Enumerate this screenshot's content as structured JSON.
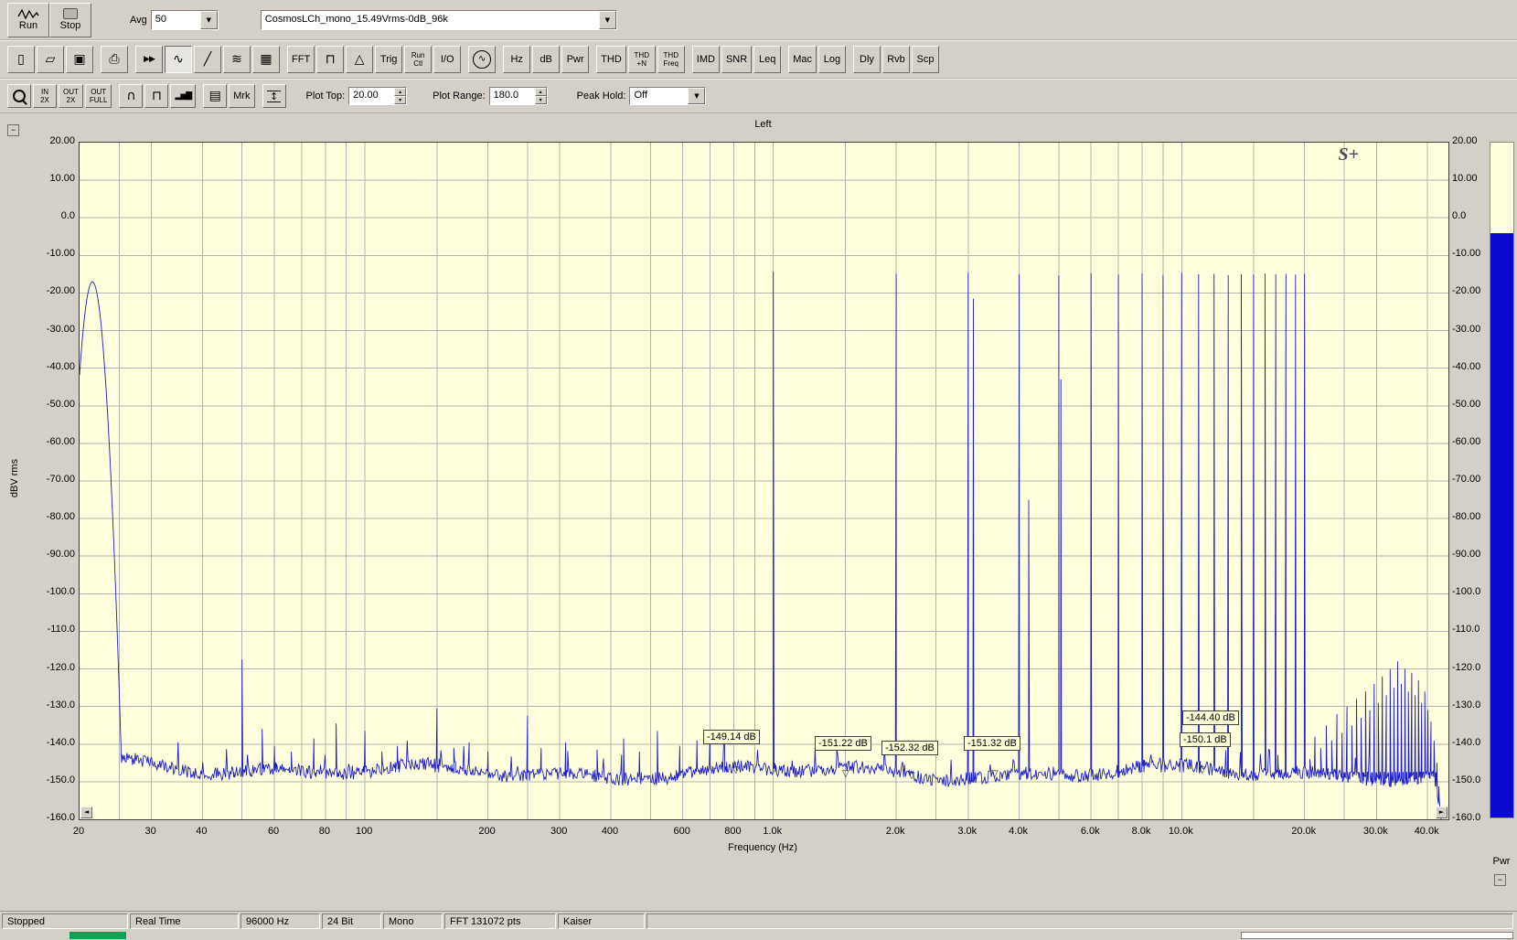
{
  "window": {
    "bg": "#d4d0c8"
  },
  "icons": {
    "collapse": "−",
    "scroll_left": "◄",
    "scroll_right": "►",
    "spin_up": "▴",
    "spin_down": "▾",
    "dropdown": "▼"
  },
  "logo_text": "S+",
  "toolbar_top": {
    "run": {
      "label": "Run"
    },
    "stop": {
      "label": "Stop"
    },
    "avg_label": "Avg",
    "avg_value": "50",
    "file_combo": "CosmosLCh_mono_15.49Vrms-0dB_96k"
  },
  "toolbar_main": {
    "groups": [
      [
        {
          "name": "new-file-button",
          "glyph": "▯"
        },
        {
          "name": "open-file-button",
          "glyph": "▱"
        },
        {
          "name": "save-button",
          "glyph": "▣"
        }
      ],
      [
        {
          "name": "print-button",
          "glyph": "⎙"
        }
      ],
      [
        {
          "name": "fast-forward-button",
          "glyph": "▶▶",
          "small": true
        },
        {
          "name": "spectrum-view-button",
          "glyph": "∿",
          "pressed": true
        },
        {
          "name": "slope-line-button",
          "glyph": "╱"
        },
        {
          "name": "multi-spectra-button",
          "glyph": "≋"
        },
        {
          "name": "spectrogram-view-button",
          "glyph": "▦"
        }
      ],
      [
        {
          "name": "fft-button",
          "label": "FFT"
        },
        {
          "name": "step-plot-button",
          "glyph": "⊓"
        },
        {
          "name": "sweep-button",
          "glyph": "△"
        },
        {
          "name": "trigger-button",
          "label": "Trig"
        },
        {
          "name": "run-control-button",
          "lines": [
            "Run",
            "Ctl"
          ]
        },
        {
          "name": "io-button",
          "label": "I/O"
        }
      ],
      [
        {
          "name": "signal-generator-button",
          "glyph": "∿",
          "circle": true
        }
      ],
      [
        {
          "name": "hz-button",
          "label": "Hz"
        },
        {
          "name": "db-button",
          "label": "dB"
        },
        {
          "name": "pwr-button",
          "label": "Pwr"
        }
      ],
      [
        {
          "name": "thd-button",
          "label": "THD"
        },
        {
          "name": "thd-n-button",
          "lines": [
            "THD",
            "+N"
          ]
        },
        {
          "name": "thd-freq-button",
          "lines": [
            "THD",
            "Freq"
          ]
        }
      ],
      [
        {
          "name": "imd-button",
          "label": "IMD"
        },
        {
          "name": "snr-button",
          "label": "SNR"
        },
        {
          "name": "leq-button",
          "label": "Leq"
        }
      ],
      [
        {
          "name": "mac-button",
          "label": "Mac"
        },
        {
          "name": "log-button",
          "label": "Log"
        }
      ],
      [
        {
          "name": "dly-button",
          "label": "Dly"
        },
        {
          "name": "rvb-button",
          "label": "Rvb"
        },
        {
          "name": "scp-button",
          "label": "Scp"
        }
      ]
    ]
  },
  "toolbar_plot": {
    "groups": [
      [
        {
          "name": "zoom-button",
          "mag": true
        },
        {
          "name": "zoom-in-2x-button",
          "lines": [
            "IN",
            "2X"
          ]
        },
        {
          "name": "zoom-out-2x-button",
          "lines": [
            "OUT",
            "2X"
          ]
        },
        {
          "name": "zoom-out-full-button",
          "lines": [
            "OUT",
            "FULL"
          ]
        }
      ],
      [
        {
          "name": "probability-plot-button",
          "glyph": "∩"
        },
        {
          "name": "pulse-plot-button",
          "glyph": "⊓"
        },
        {
          "name": "histogram-button",
          "glyph": "▂▅▇",
          "small": true
        }
      ],
      [
        {
          "name": "display-config-button",
          "glyph": "▤"
        },
        {
          "name": "marker-toggle-button",
          "label": "Mrk"
        }
      ],
      [
        {
          "name": "cursor-readout-button",
          "glyph": "↕",
          "boxed": true
        }
      ]
    ],
    "plot_top_label": "Plot Top:",
    "plot_top_value": "20.00",
    "plot_range_label": "Plot Range:",
    "plot_range_value": "180.0",
    "peak_hold_label": "Peak Hold:",
    "peak_hold_value": "Off"
  },
  "chart_data": {
    "type": "line",
    "title": "Left",
    "xlabel": "Frequency (Hz)",
    "ylabel": "dBV rms",
    "x_scale": "log",
    "xlim": [
      20,
      45000
    ],
    "ylim": [
      -160,
      20
    ],
    "bg": "#ffffde",
    "grid_color": "#b3b3b3",
    "trace_color": "#1e1ec8",
    "y_tick_labels": [
      "20.00",
      "10.00",
      "0.0",
      "-10.00",
      "-20.00",
      "-30.00",
      "-40.00",
      "-50.00",
      "-60.00",
      "-70.00",
      "-80.00",
      "-90.00",
      "-100.0",
      "-110.0",
      "-120.0",
      "-130.0",
      "-140.0",
      "-150.0",
      "-160.0"
    ],
    "x_ticks": [
      [
        "20",
        20
      ],
      [
        "30",
        30
      ],
      [
        "40",
        40
      ],
      [
        "60",
        60
      ],
      [
        "80",
        80
      ],
      [
        "100",
        100
      ],
      [
        "200",
        200
      ],
      [
        "300",
        300
      ],
      [
        "400",
        400
      ],
      [
        "600",
        600
      ],
      [
        "800",
        800
      ],
      [
        "1.0k",
        1000
      ],
      [
        "2.0k",
        2000
      ],
      [
        "3.0k",
        3000
      ],
      [
        "4.0k",
        4000
      ],
      [
        "6.0k",
        6000
      ],
      [
        "8.0k",
        8000
      ],
      [
        "10.0k",
        10000
      ],
      [
        "20.0k",
        20000
      ],
      [
        "30.0k",
        30000
      ],
      [
        "40.0k",
        40000
      ]
    ],
    "grid_freqs": [
      25,
      30,
      40,
      50,
      60,
      70,
      80,
      90,
      100,
      150,
      200,
      250,
      300,
      400,
      500,
      600,
      700,
      800,
      900,
      1000,
      1500,
      2000,
      2500,
      3000,
      4000,
      5000,
      6000,
      7000,
      8000,
      9000,
      10000,
      15000,
      20000,
      25000,
      30000,
      40000
    ],
    "noise_floor_db": -147.5,
    "lf_hump": {
      "f": 21.5,
      "db": -17
    },
    "mains_peak": {
      "f": 50,
      "db": -117.5
    },
    "tones": [
      [
        1000,
        -14.4
      ],
      [
        2000,
        -14.9
      ],
      [
        3000,
        -14.6
      ],
      [
        4000,
        -15.0
      ],
      [
        5000,
        -15.3
      ],
      [
        6000,
        -14.7
      ],
      [
        7000,
        -15.1
      ],
      [
        8000,
        -14.8
      ],
      [
        9000,
        -15.2
      ],
      [
        10000,
        -14.6
      ],
      [
        11000,
        -15.0
      ],
      [
        12000,
        -14.9
      ],
      [
        13000,
        -15.2
      ],
      [
        14000,
        -15.0
      ],
      [
        15000,
        -15.1
      ],
      [
        16000,
        -14.8
      ],
      [
        17000,
        -15.0
      ],
      [
        18000,
        -14.9
      ],
      [
        19000,
        -15.1
      ],
      [
        20000,
        -14.9
      ]
    ],
    "spurs": [
      [
        56,
        -136
      ],
      [
        60,
        -140.5
      ],
      [
        66,
        -142
      ],
      [
        75,
        -138.5
      ],
      [
        85,
        -134.5
      ],
      [
        100,
        -136.5
      ],
      [
        110,
        -142
      ],
      [
        120,
        -140.5
      ],
      [
        150,
        -130.5
      ],
      [
        165,
        -141
      ],
      [
        180,
        -139.5
      ],
      [
        200,
        -142
      ],
      [
        250,
        -132.5
      ],
      [
        270,
        -141
      ],
      [
        310,
        -139.5
      ],
      [
        370,
        -141.5
      ],
      [
        430,
        -138.5
      ],
      [
        470,
        -142
      ],
      [
        520,
        -136.5
      ],
      [
        590,
        -140.5
      ],
      [
        650,
        -139
      ],
      [
        700,
        -136.5
      ],
      [
        760,
        -140.5
      ],
      [
        3090,
        -21.5
      ],
      [
        4220,
        -75
      ],
      [
        5060,
        -43
      ]
    ],
    "hf_spikes": [
      [
        20600,
        -144
      ],
      [
        21200,
        -138
      ],
      [
        21900,
        -141
      ],
      [
        22600,
        -135
      ],
      [
        23300,
        -139
      ],
      [
        24000,
        -132
      ],
      [
        24700,
        -137
      ],
      [
        25400,
        -130
      ],
      [
        26100,
        -135
      ],
      [
        26800,
        -128
      ],
      [
        27500,
        -133
      ],
      [
        28200,
        -126
      ],
      [
        28900,
        -131
      ],
      [
        29600,
        -124
      ],
      [
        30300,
        -129
      ],
      [
        31000,
        -122
      ],
      [
        31700,
        -127
      ],
      [
        32400,
        -120
      ],
      [
        33100,
        -125
      ],
      [
        33800,
        -118
      ],
      [
        34500,
        -124
      ],
      [
        35200,
        -120
      ],
      [
        35900,
        -126
      ],
      [
        36600,
        -121
      ],
      [
        37300,
        -127
      ],
      [
        38000,
        -123
      ],
      [
        38700,
        -129
      ],
      [
        39400,
        -126
      ],
      [
        40100,
        -131
      ],
      [
        40800,
        -134
      ],
      [
        41500,
        -139
      ],
      [
        42200,
        -145
      ]
    ],
    "hf_rolloff_start": 41800,
    "markers": [
      {
        "text": "-149.14 dB",
        "f": 673,
        "db": -138.1,
        "arrow_f": 815,
        "arrow_db": -147
      },
      {
        "text": "-151.22 dB",
        "f": 1263,
        "db": -139.8,
        "arrow_f": 1513,
        "arrow_db": -148
      },
      {
        "text": "-152.32 dB",
        "f": 1841,
        "db": -141.0,
        "arrow_f": 2194,
        "arrow_db": -148.5
      },
      {
        "text": "-151.32 dB",
        "f": 2929,
        "db": -139.8,
        "arrow_f": 3507,
        "arrow_db": -148
      },
      {
        "text": "-144.40 dB",
        "f": 10038,
        "db": -133.0
      },
      {
        "text": "-150.1 dB",
        "f": 9900,
        "db": -138.9,
        "arrow_f": 11303,
        "arrow_db": -147
      }
    ],
    "power_bar": {
      "level_db": -4,
      "label": "Pwr",
      "color": "#0a0acd"
    }
  },
  "status_bar": {
    "cells": [
      "Stopped",
      "Real Time",
      "96000 Hz",
      "24 Bit",
      "Mono",
      "FFT 131072 pts",
      "Kaiser",
      ""
    ]
  }
}
